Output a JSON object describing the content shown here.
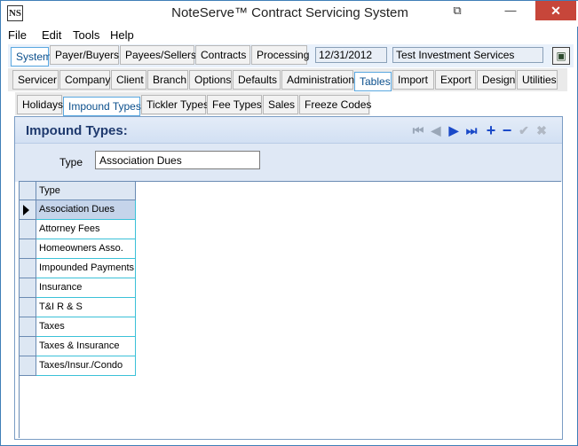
{
  "window": {
    "title": "NoteServe™ Contract Servicing System",
    "app_icon_text": "NS",
    "restore_glyph": "⧉",
    "min_glyph": "—",
    "close_glyph": "✕"
  },
  "menu": [
    "File",
    "Edit",
    "Tools",
    "Help"
  ],
  "top_tabs": [
    "System",
    "Payer/Buyers",
    "Payees/Sellers",
    "Contracts",
    "Processing"
  ],
  "status": {
    "date": "12/31/2012",
    "company": "Test Investment Services"
  },
  "system_tabs": [
    "Servicer",
    "Company",
    "Client",
    "Branch",
    "Options",
    "Defaults",
    "Administration",
    "Tables",
    "Import",
    "Export",
    "Design",
    "Utilities"
  ],
  "table_tabs": [
    "Holidays",
    "Impound Types",
    "Tickler Types",
    "Fee Types",
    "Sales",
    "Freeze Codes"
  ],
  "panel": {
    "title": "Impound Types:",
    "type_label": "Type",
    "type_value": "Association Dues"
  },
  "navigator": [
    "first-icon",
    "prior-icon",
    "next-icon",
    "last-icon",
    "insert-icon",
    "delete-icon",
    "post-icon",
    "cancel-icon"
  ],
  "grid": {
    "column_header": "Type",
    "rows": [
      "Association Dues",
      "Attorney Fees",
      "Homeowners Asso.",
      "Impounded Payments",
      "Insurance",
      "T&I R & S",
      "Taxes",
      "Taxes & Insurance",
      "Taxes/Insur./Condo"
    ]
  },
  "colors": {
    "accent": "#0b4f8c",
    "panel_title": "#1f3a6e",
    "nav_blue": "#1a49c8",
    "close_red": "#c7463a"
  }
}
